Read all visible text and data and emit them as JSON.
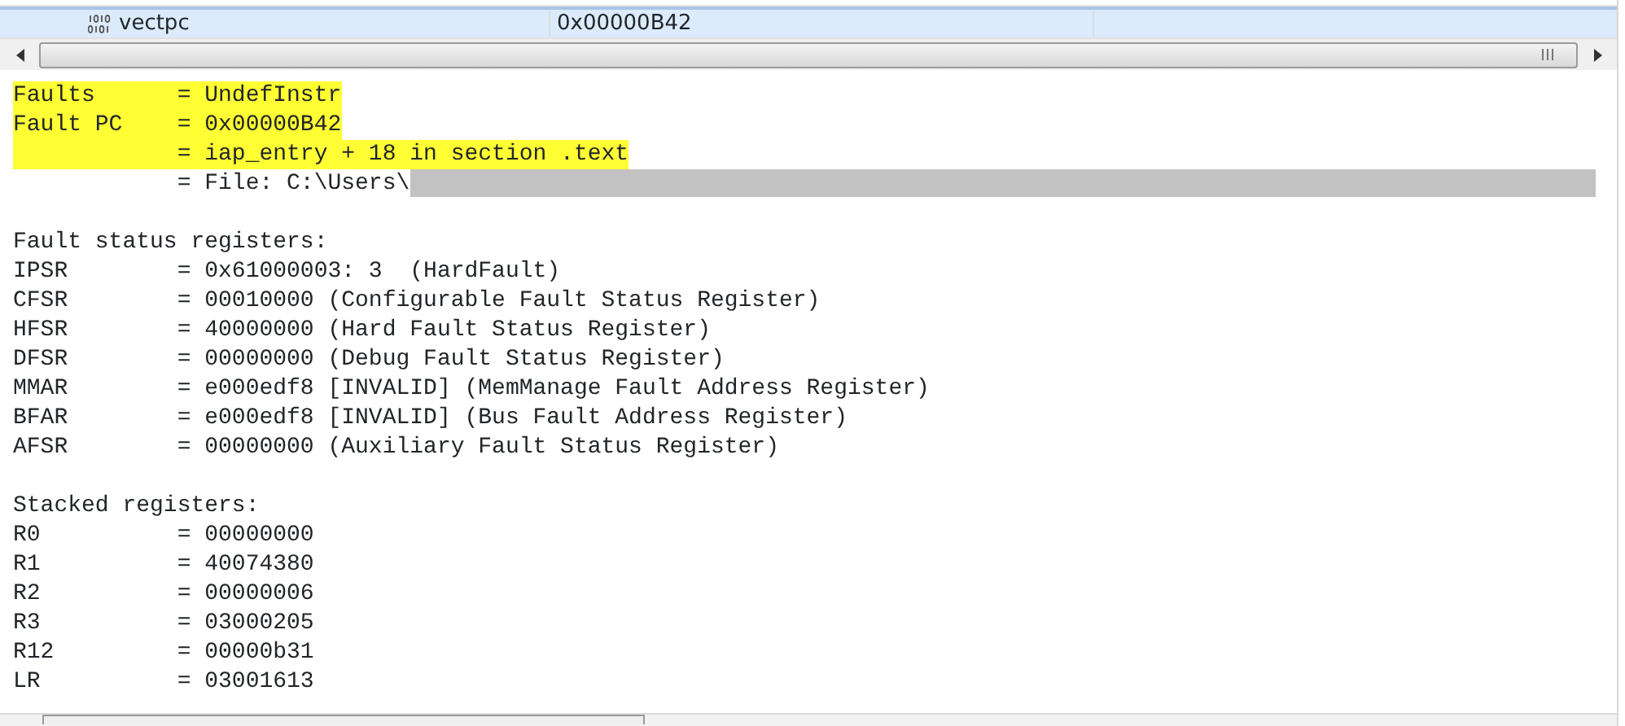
{
  "variables_table": {
    "rows": [
      {
        "name": "vectpc",
        "value": "0x00000B42",
        "selected": true
      }
    ]
  },
  "output": {
    "blocks": [
      {
        "lines": [
          {
            "text": "Faults      = UndefInstr",
            "highlighted": true
          },
          {
            "text": "Fault PC    = 0x00000B42",
            "highlighted": true
          },
          {
            "text": "            = iap_entry + 18 in section .text",
            "highlighted": true
          },
          {
            "text": "            = File: C:\\Users\\",
            "highlighted": false,
            "redacted": true
          }
        ]
      },
      {
        "lines": [
          {
            "text": "Fault status registers:",
            "highlighted": false
          },
          {
            "text": "IPSR        = 0x61000003: 3  (HardFault)",
            "highlighted": false
          },
          {
            "text": "CFSR        = 00010000 (Configurable Fault Status Register)",
            "highlighted": false
          },
          {
            "text": "HFSR        = 40000000 (Hard Fault Status Register)",
            "highlighted": false
          },
          {
            "text": "DFSR        = 00000000 (Debug Fault Status Register)",
            "highlighted": false
          },
          {
            "text": "MMAR        = e000edf8 [INVALID] (MemManage Fault Address Register)",
            "highlighted": false
          },
          {
            "text": "BFAR        = e000edf8 [INVALID] (Bus Fault Address Register)",
            "highlighted": false
          },
          {
            "text": "AFSR        = 00000000 (Auxiliary Fault Status Register)",
            "highlighted": false
          }
        ]
      },
      {
        "lines": [
          {
            "text": "Stacked registers:",
            "highlighted": false
          },
          {
            "text": "R0          = 00000000",
            "highlighted": false
          },
          {
            "text": "R1          = 40074380",
            "highlighted": false
          },
          {
            "text": "R2          = 00000006",
            "highlighted": false
          },
          {
            "text": "R3          = 03000205",
            "highlighted": false
          },
          {
            "text": "R12         = 00000b31",
            "highlighted": false
          },
          {
            "text": "LR          = 03001613",
            "highlighted": false
          }
        ]
      }
    ]
  }
}
